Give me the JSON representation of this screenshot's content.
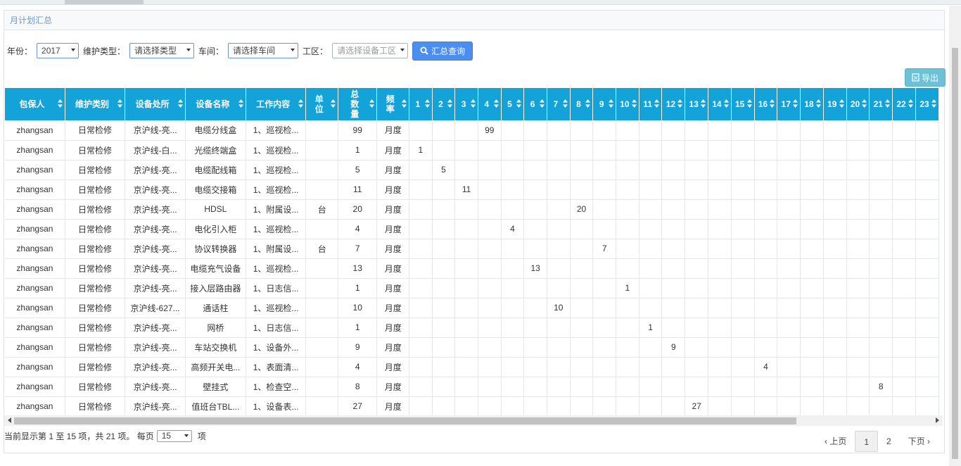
{
  "panel": {
    "title": "月计划汇总"
  },
  "filters": {
    "year_label": "年份：",
    "year_value": "2017",
    "type_label": "维护类型：",
    "type_value": "请选择类型",
    "workshop_label": "车间：",
    "workshop_value": "请选择车间",
    "area_label": "工区：",
    "area_value": "请选择设备工区",
    "query_button": "汇总查询"
  },
  "toolbar": {
    "export_label": "导出"
  },
  "table": {
    "fixed_headers": [
      "包保人",
      "维护类别",
      "设备处所",
      "设备名称",
      "工作内容",
      "单位",
      "总数量",
      "频率"
    ],
    "day_headers": [
      "1",
      "2",
      "3",
      "4",
      "5",
      "6",
      "7",
      "8",
      "9",
      "10",
      "11",
      "12",
      "13",
      "14",
      "15",
      "16",
      "17",
      "18",
      "19",
      "20",
      "21",
      "22",
      "23"
    ],
    "rows": [
      {
        "person": "zhangsan",
        "category": "日常检修",
        "location": "京沪线-亮...",
        "device": "电缆分线盒",
        "work": "1、巡视检...",
        "unit": "",
        "total": "99",
        "freq": "月度",
        "day": 4
      },
      {
        "person": "zhangsan",
        "category": "日常检修",
        "location": "京沪线-白...",
        "device": "光缆终端盒",
        "work": "1、巡视检...",
        "unit": "",
        "total": "1",
        "freq": "月度",
        "day": 1
      },
      {
        "person": "zhangsan",
        "category": "日常检修",
        "location": "京沪线-亮...",
        "device": "电缆配线箱",
        "work": "1、巡视检...",
        "unit": "",
        "total": "5",
        "freq": "月度",
        "day": 2
      },
      {
        "person": "zhangsan",
        "category": "日常检修",
        "location": "京沪线-亮...",
        "device": "电缆交接箱",
        "work": "1、巡视检...",
        "unit": "",
        "total": "11",
        "freq": "月度",
        "day": 3
      },
      {
        "person": "zhangsan",
        "category": "日常检修",
        "location": "京沪线-亮...",
        "device": "HDSL",
        "work": "1、附属设...",
        "unit": "台",
        "total": "20",
        "freq": "月度",
        "day": 8
      },
      {
        "person": "zhangsan",
        "category": "日常检修",
        "location": "京沪线-亮...",
        "device": "电化引入柜",
        "work": "1、巡视检...",
        "unit": "",
        "total": "4",
        "freq": "月度",
        "day": 5
      },
      {
        "person": "zhangsan",
        "category": "日常检修",
        "location": "京沪线-亮...",
        "device": "协议转换器",
        "work": "1、附属设...",
        "unit": "台",
        "total": "7",
        "freq": "月度",
        "day": 9
      },
      {
        "person": "zhangsan",
        "category": "日常检修",
        "location": "京沪线-亮...",
        "device": "电缆充气设备",
        "work": "1、巡视检...",
        "unit": "",
        "total": "13",
        "freq": "月度",
        "day": 6
      },
      {
        "person": "zhangsan",
        "category": "日常检修",
        "location": "京沪线-亮...",
        "device": "接入层路由器",
        "work": "1、日志信...",
        "unit": "",
        "total": "1",
        "freq": "月度",
        "day": 10
      },
      {
        "person": "zhangsan",
        "category": "日常检修",
        "location": "京沪线-627...",
        "device": "通话柱",
        "work": "1、巡视检...",
        "unit": "",
        "total": "10",
        "freq": "月度",
        "day": 7
      },
      {
        "person": "zhangsan",
        "category": "日常检修",
        "location": "京沪线-亮...",
        "device": "网桥",
        "work": "1、日志信...",
        "unit": "",
        "total": "1",
        "freq": "月度",
        "day": 11
      },
      {
        "person": "zhangsan",
        "category": "日常检修",
        "location": "京沪线-亮...",
        "device": "车站交换机",
        "work": "1、设备外...",
        "unit": "",
        "total": "9",
        "freq": "月度",
        "day": 12
      },
      {
        "person": "zhangsan",
        "category": "日常检修",
        "location": "京沪线-亮...",
        "device": "高频开关电...",
        "work": "1、表面清...",
        "unit": "",
        "total": "4",
        "freq": "月度",
        "day": 16
      },
      {
        "person": "zhangsan",
        "category": "日常检修",
        "location": "京沪线-亮...",
        "device": "壁挂式",
        "work": "1、检查空...",
        "unit": "",
        "total": "8",
        "freq": "月度",
        "day": 21
      },
      {
        "person": "zhangsan",
        "category": "日常检修",
        "location": "京沪线-亮...",
        "device": "值班台TBL...",
        "work": "1、设备表...",
        "unit": "",
        "total": "27",
        "freq": "月度",
        "day": 13
      }
    ]
  },
  "footer": {
    "info_text": "当前显示第 1 至 15 项，共 21 项。 每页",
    "page_size": "15",
    "info_suffix": "项"
  },
  "pager": {
    "prev": "‹ 上页",
    "pages": [
      "1",
      "2"
    ],
    "next": "下页 ›"
  },
  "colors": {
    "header_bg": "#13a3d8",
    "primary": "#4b8ef0",
    "export": "#6bc1d6",
    "panel_title": "#6e98c6"
  }
}
